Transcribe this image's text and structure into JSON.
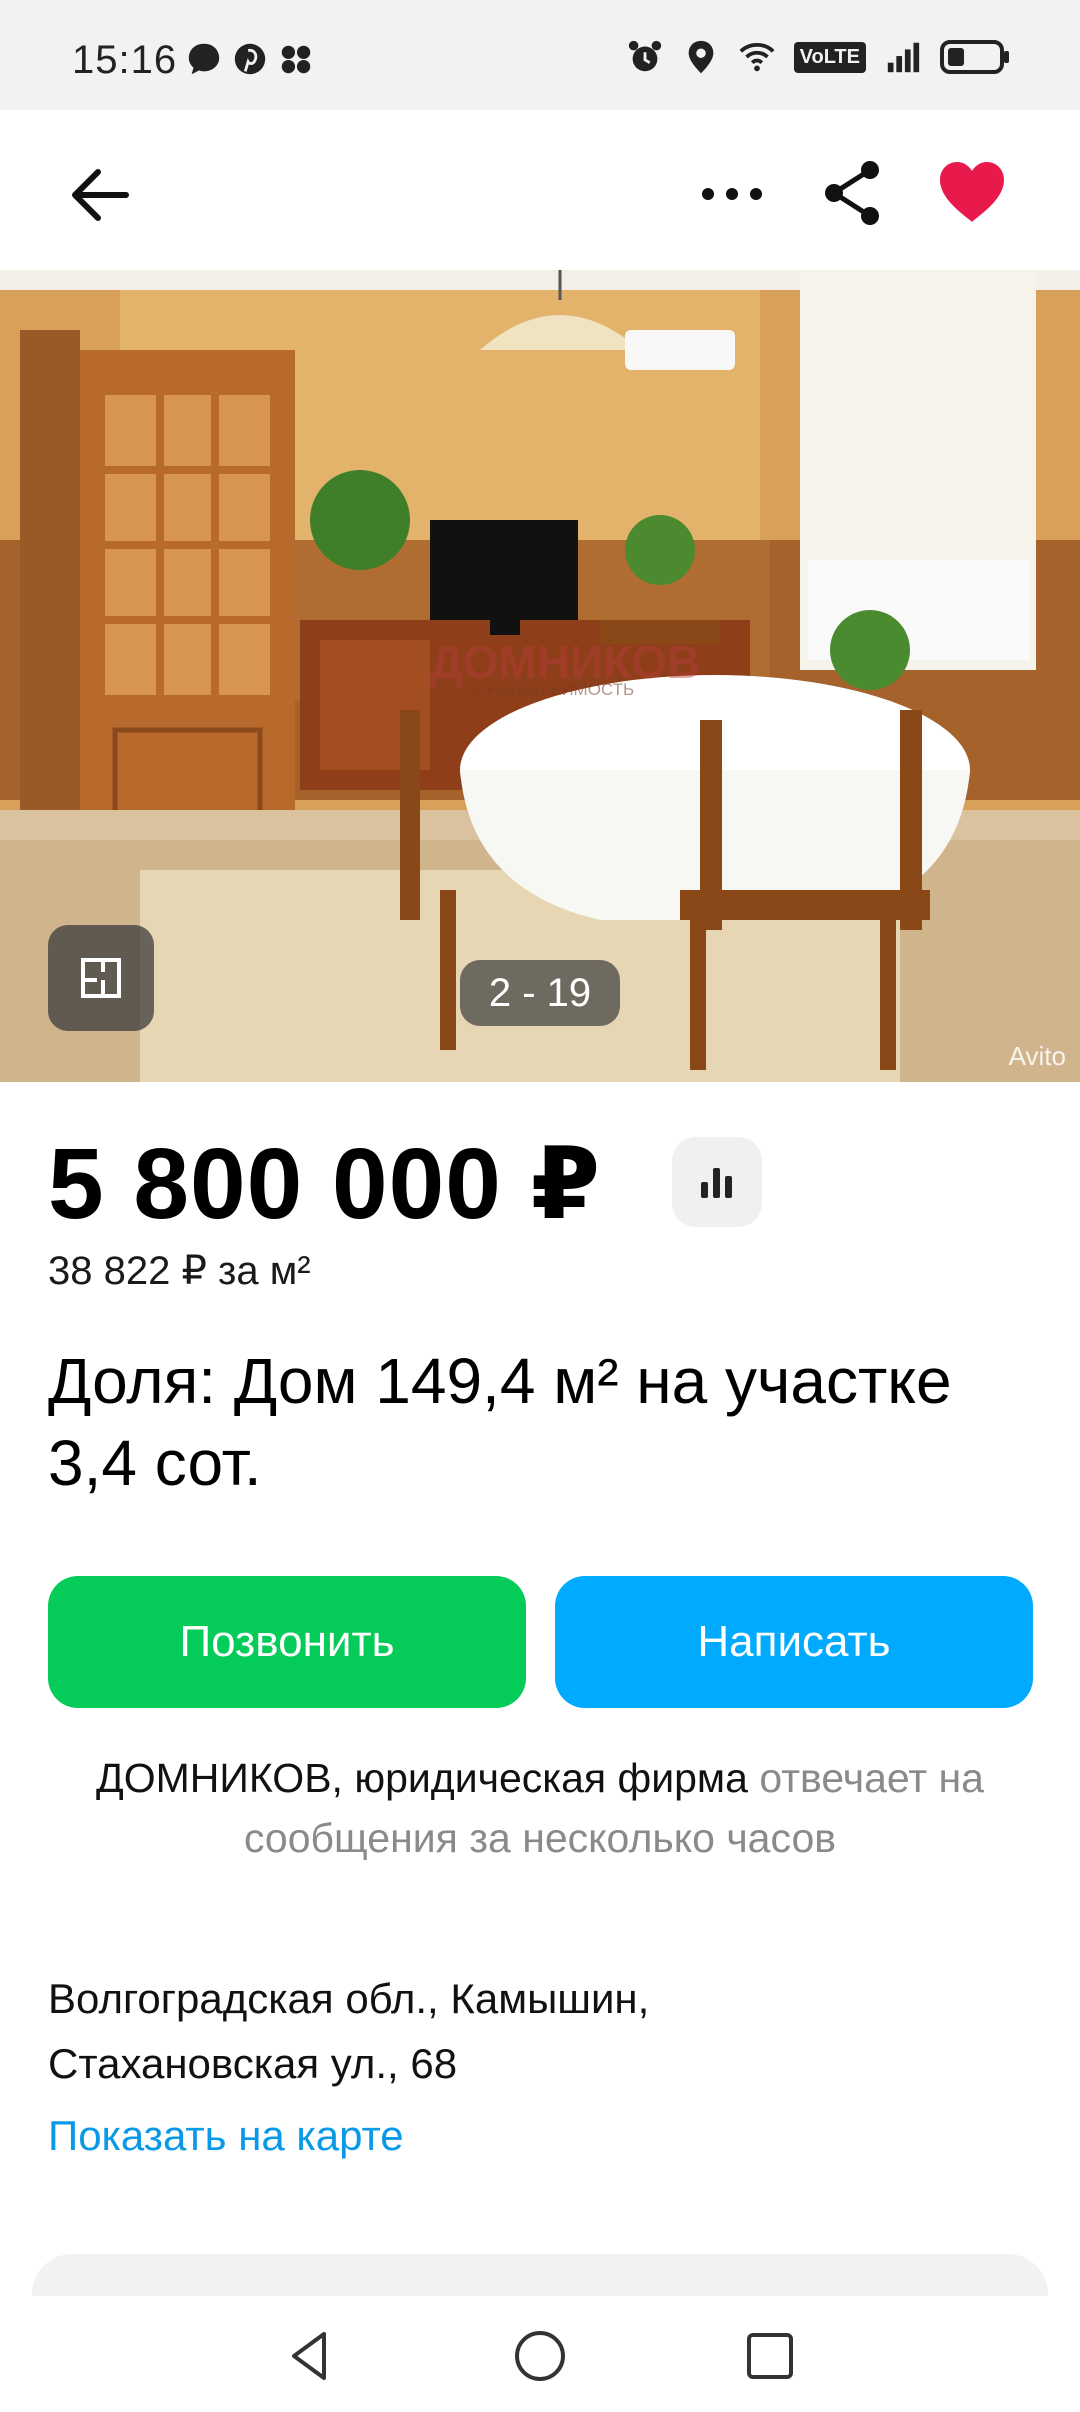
{
  "status_bar": {
    "time": "15:16",
    "left_icons": [
      "chat-bubble-icon",
      "pinterest-icon",
      "app-cluster-icon"
    ],
    "right_icons": [
      "alarm-icon",
      "location-icon",
      "wifi-icon",
      "volte-icon",
      "signal-icon",
      "battery-icon"
    ],
    "volte_label": "VoLTE"
  },
  "app_bar": {
    "icons": [
      "arrow-left-icon",
      "more-dots-icon",
      "share-icon",
      "heart-icon"
    ],
    "favorite_color": "#e8194b"
  },
  "gallery": {
    "counter": "2 - 19",
    "current_index": 2,
    "total": 19,
    "watermark_brand": "ДОМНИКОВ",
    "watermark_sub": "И НЕДВИЖИМОСТЬ",
    "avito_mark": "Avito"
  },
  "listing": {
    "price": "5 800 000 ₽",
    "price_per_m2": "38 822 ₽ за м²",
    "title": "Доля: Дом 149,4 м² на участке 3,4 сот."
  },
  "actions": {
    "call_label": "Позвонить",
    "write_label": "Написать",
    "call_color": "#05cc58",
    "write_color": "#00aaff"
  },
  "seller": {
    "name": "ДОМНИКОВ, юридическая фирма",
    "response": "отвечает на сообщения за несколько часов"
  },
  "location": {
    "address_line1": "Волгоградская обл., Камышин,",
    "address_line2": "Стахановская ул., 68",
    "map_link": "Показать на карте"
  },
  "nav_bar": {
    "buttons": [
      "nav-back-icon",
      "nav-home-icon",
      "nav-recents-icon"
    ]
  }
}
